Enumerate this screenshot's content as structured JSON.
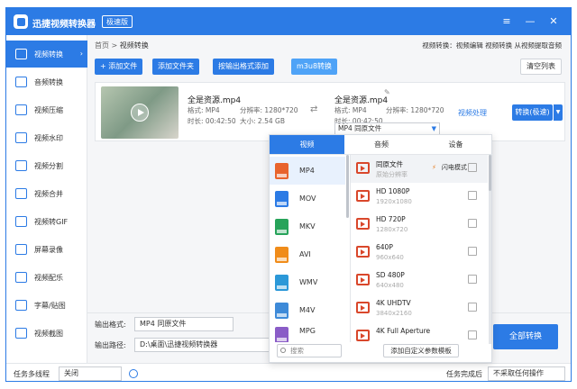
{
  "app": {
    "title": "迅捷视频转换器",
    "edition": "极速版"
  },
  "window_controls": {
    "menu": "≡",
    "minimize": "—",
    "close": "✕"
  },
  "sidebar": {
    "items": [
      {
        "label": "视频转换",
        "icon": "video-convert-icon",
        "active": true
      },
      {
        "label": "音频转换",
        "icon": "audio-convert-icon"
      },
      {
        "label": "视频压缩",
        "icon": "compress-icon"
      },
      {
        "label": "视频水印",
        "icon": "watermark-icon"
      },
      {
        "label": "视频分割",
        "icon": "split-icon"
      },
      {
        "label": "视频合并",
        "icon": "merge-icon"
      },
      {
        "label": "视频转GIF",
        "icon": "gif-icon"
      },
      {
        "label": "屏幕录像",
        "icon": "screen-record-icon"
      },
      {
        "label": "视频配乐",
        "icon": "music-icon"
      },
      {
        "label": "字幕/贴图",
        "icon": "subtitle-icon"
      },
      {
        "label": "视频截图",
        "icon": "screenshot-icon"
      }
    ],
    "arrow": "›"
  },
  "breadcrumb": {
    "home": "首页",
    "separator": ">",
    "current": "视频转换"
  },
  "feature_links": "视频转换：视频编辑 视频转换 从视频提取音频",
  "toolbar": {
    "add_file": "+ 添加文件",
    "add_folder": "添加文件夹",
    "add_by_format": "按输出格式添加",
    "m3u8": "m3u8转换",
    "clear_list": "清空列表"
  },
  "file": {
    "source": {
      "name": "全是资源.mp4",
      "format_label": "格式:",
      "format": "MP4",
      "res_label": "分辨率:",
      "resolution": "1280*720",
      "duration_label": "时长:",
      "duration": "00:42:50",
      "size_label": "大小:",
      "size": "2.54 GB"
    },
    "target": {
      "name": "全是资源.mp4",
      "format_label": "格式:",
      "format": "MP4",
      "res_label": "分辨率:",
      "resolution": "1280*720",
      "duration_label": "时长:",
      "duration": "00:42:50",
      "output": "MP4 同原文件"
    },
    "process": "视频处理",
    "convert": "转换(极速)"
  },
  "popup": {
    "tabs": [
      "视频",
      "音频",
      "设备"
    ],
    "formats": [
      {
        "label": "MP4",
        "color": "#e8632c"
      },
      {
        "label": "MOV",
        "color": "#2c7be5"
      },
      {
        "label": "MKV",
        "color": "#27a35a"
      },
      {
        "label": "AVI",
        "color": "#f08c1a"
      },
      {
        "label": "WMV",
        "color": "#2b98d8"
      },
      {
        "label": "M4V",
        "color": "#3e8ad8"
      },
      {
        "label": "MPG",
        "color": "#8a5cc7"
      }
    ],
    "presets": [
      {
        "name": "同原文件",
        "sub": "原始分辨率"
      },
      {
        "name": "HD 1080P",
        "sub": "1920x1080"
      },
      {
        "name": "HD 720P",
        "sub": "1280x720"
      },
      {
        "name": "640P",
        "sub": "960x640"
      },
      {
        "name": "SD 480P",
        "sub": "640x480"
      },
      {
        "name": "4K UHDTV",
        "sub": "3840x2160"
      },
      {
        "name": "4K Full Aperture",
        "sub": ""
      }
    ],
    "flash_mode": "闪电模式",
    "search_placeholder": "搜索",
    "add_template": "添加自定义参数模板"
  },
  "bottom": {
    "format_label": "输出格式:",
    "format_value": "MP4 同原文件",
    "path_label": "输出路径:",
    "path_value": "D:\\桌面\\迅捷视频转换器",
    "convert_all": "全部转换"
  },
  "status": {
    "multithread_label": "任务多线程",
    "multithread_value": "关闭",
    "done_label": "任务完成后",
    "done_value": "不采取任何操作"
  }
}
